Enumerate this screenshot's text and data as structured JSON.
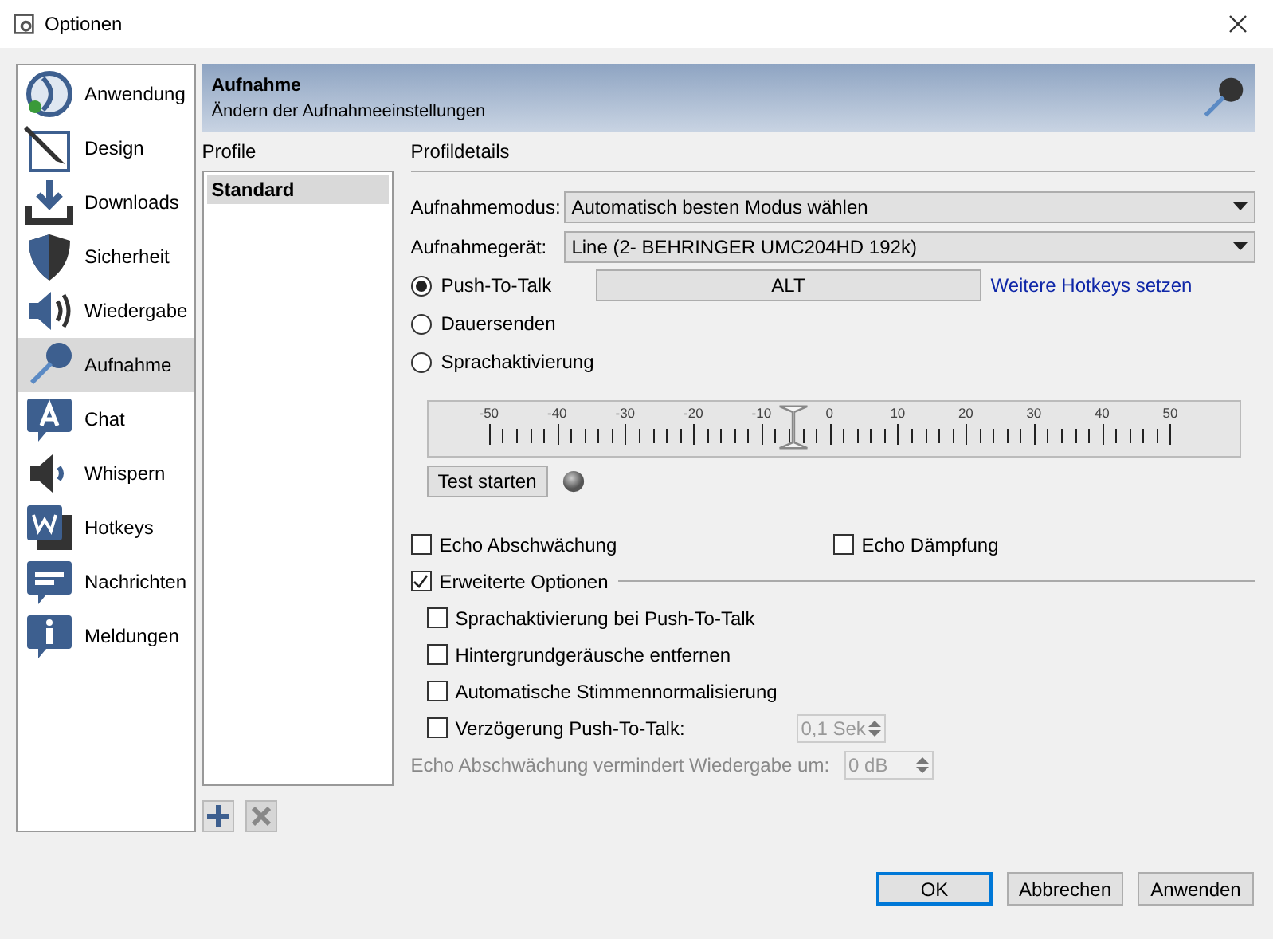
{
  "window": {
    "title": "Optionen"
  },
  "sidebar": {
    "items": [
      {
        "label": "Anwendung",
        "selected": false
      },
      {
        "label": "Design",
        "selected": false
      },
      {
        "label": "Downloads",
        "selected": false
      },
      {
        "label": "Sicherheit",
        "selected": false
      },
      {
        "label": "Wiedergabe",
        "selected": false
      },
      {
        "label": "Aufnahme",
        "selected": true
      },
      {
        "label": "Chat",
        "selected": false
      },
      {
        "label": "Whispern",
        "selected": false
      },
      {
        "label": "Hotkeys",
        "selected": false
      },
      {
        "label": "Nachrichten",
        "selected": false
      },
      {
        "label": "Meldungen",
        "selected": false
      }
    ]
  },
  "header": {
    "title": "Aufnahme",
    "subtitle": "Ändern der Aufnahmeeinstellungen"
  },
  "profiles": {
    "label": "Profile",
    "items": [
      {
        "label": "Standard",
        "selected": true
      }
    ],
    "add_disabled": false,
    "remove_disabled": true
  },
  "details": {
    "label": "Profildetails",
    "fields": [
      {
        "label": "Aufnahmemodus:",
        "value": "Automatisch besten Modus wählen"
      },
      {
        "label": "Aufnahmegerät:",
        "value": "Line (2- BEHRINGER UMC204HD 192k)"
      }
    ],
    "modes": [
      {
        "label": "Push-To-Talk",
        "selected": true
      },
      {
        "label": "Dauersenden",
        "selected": false
      },
      {
        "label": "Sprachaktivierung",
        "selected": false
      }
    ],
    "hotkey": "ALT",
    "hotkey_link": "Weitere Hotkeys setzen",
    "meter": {
      "ticks": [
        "-50",
        "-40",
        "-30",
        "-20",
        "-10",
        "0",
        "10",
        "20",
        "30",
        "40",
        "50"
      ],
      "level": 0.45
    },
    "test_button": "Test starten",
    "options": [
      {
        "label": "Echo Abschwächung",
        "checked": false
      },
      {
        "label": "Echo Dämpfung",
        "checked": false
      }
    ],
    "advanced": {
      "label": "Erweiterte Optionen",
      "checked": true,
      "options": [
        {
          "kind": "check",
          "label": "Sprachaktivierung bei Push-To-Talk",
          "checked": false
        },
        {
          "kind": "check",
          "label": "Hintergrundgeräusche entfernen",
          "checked": false
        },
        {
          "kind": "check",
          "label": "Automatische Stimmennormalisierung",
          "checked": false
        },
        {
          "kind": "check-spin",
          "label": "Verzögerung Push-To-Talk:",
          "checked": false,
          "value": "0,1 Sek",
          "disabled": true
        },
        {
          "kind": "label-spin",
          "label": "Echo Abschwächung vermindert Wiedergabe um:",
          "value": "0 dB",
          "disabled": true
        }
      ]
    }
  },
  "buttons": [
    {
      "label": "OK",
      "default": true
    },
    {
      "label": "Abbrechen",
      "default": false
    },
    {
      "label": "Anwenden",
      "default": false
    }
  ]
}
